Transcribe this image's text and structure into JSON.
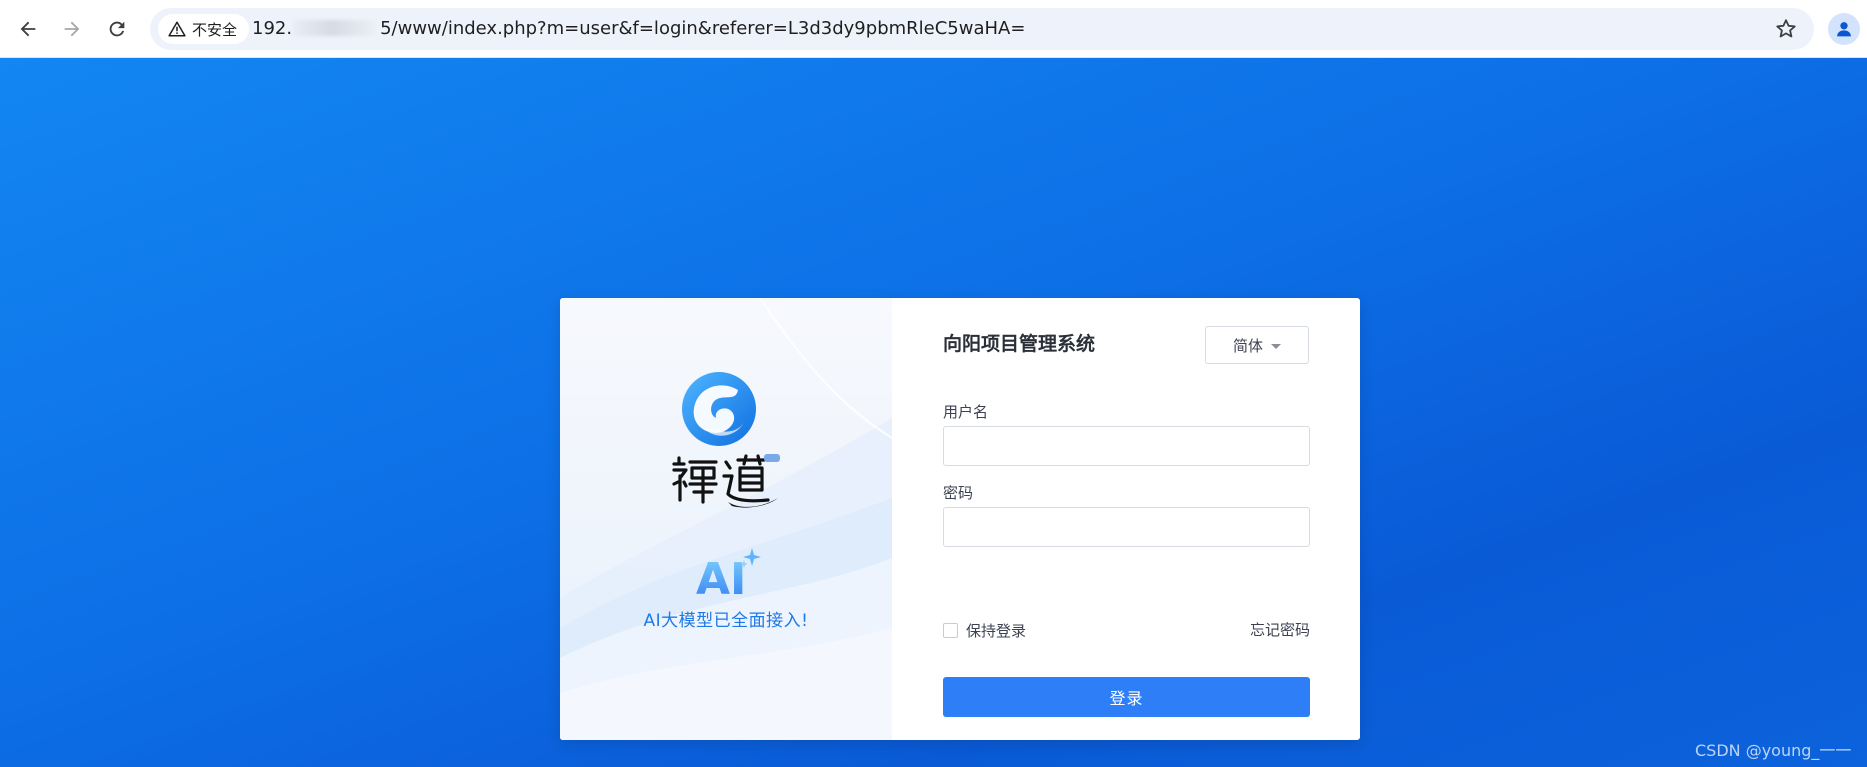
{
  "browser": {
    "security_label": "不安全",
    "url_prefix": "192.",
    "url_suffix": "5/www/index.php?m=user&f=login&referer=L3d3dy9pbmRleC5waHA=",
    "icons": [
      "back-arrow-icon",
      "forward-arrow-icon",
      "reload-icon",
      "warning-triangle-icon",
      "star-icon",
      "profile-icon"
    ]
  },
  "brand": {
    "ai_badge": "AI",
    "ai_slogan": "AI大模型已全面接入!"
  },
  "login": {
    "system_title": "向阳项目管理系统",
    "language": "简体",
    "username_label": "用户名",
    "username_value": "",
    "password_label": "密码",
    "password_value": "",
    "remember_label": "保持登录",
    "remember_checked": false,
    "forgot_label": "忘记密码",
    "submit_label": "登录"
  },
  "watermark": "CSDN @young_一一",
  "colors": {
    "background": "#0d6fe6",
    "primary_button": "#2d7ef7",
    "slogan": "#1e7ae8"
  }
}
